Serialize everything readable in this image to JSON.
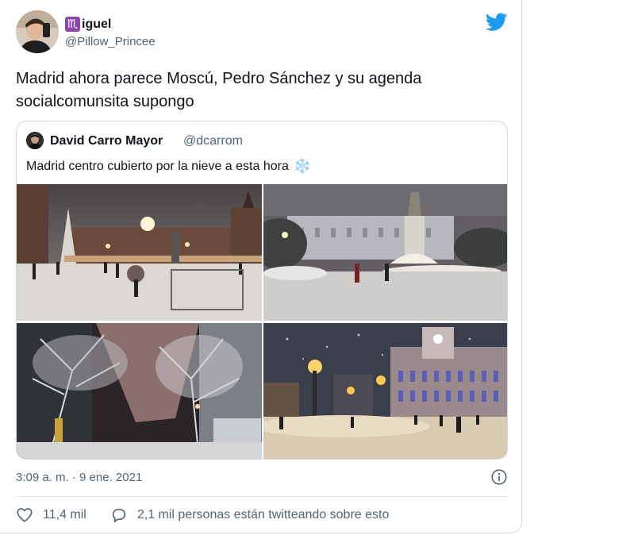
{
  "author": {
    "zodiac_glyph": "♏",
    "name_rest": "iguel",
    "handle": "@Pillow_Princee"
  },
  "tweet": {
    "text_line1": "Madrid ahora parece Moscú, Pedro Sánchez y su agenda",
    "text_line2": "socialcomunsita supongo"
  },
  "quoted": {
    "name": "David Carro Mayor",
    "handle": "@dcarrom",
    "text": "Madrid centro cubierto por la nieve a esta hora",
    "emoji": "❄️"
  },
  "meta": {
    "time": "3:09 a. m.",
    "separator": "·",
    "date": "9 ene. 2021"
  },
  "actions": {
    "likes": "11,4 mil",
    "conversation": "2,1 mil personas están twitteando sobre esto"
  },
  "colors": {
    "twitter_blue": "#1d9bf0",
    "secondary_text": "#536471",
    "border": "#cfd9de"
  }
}
